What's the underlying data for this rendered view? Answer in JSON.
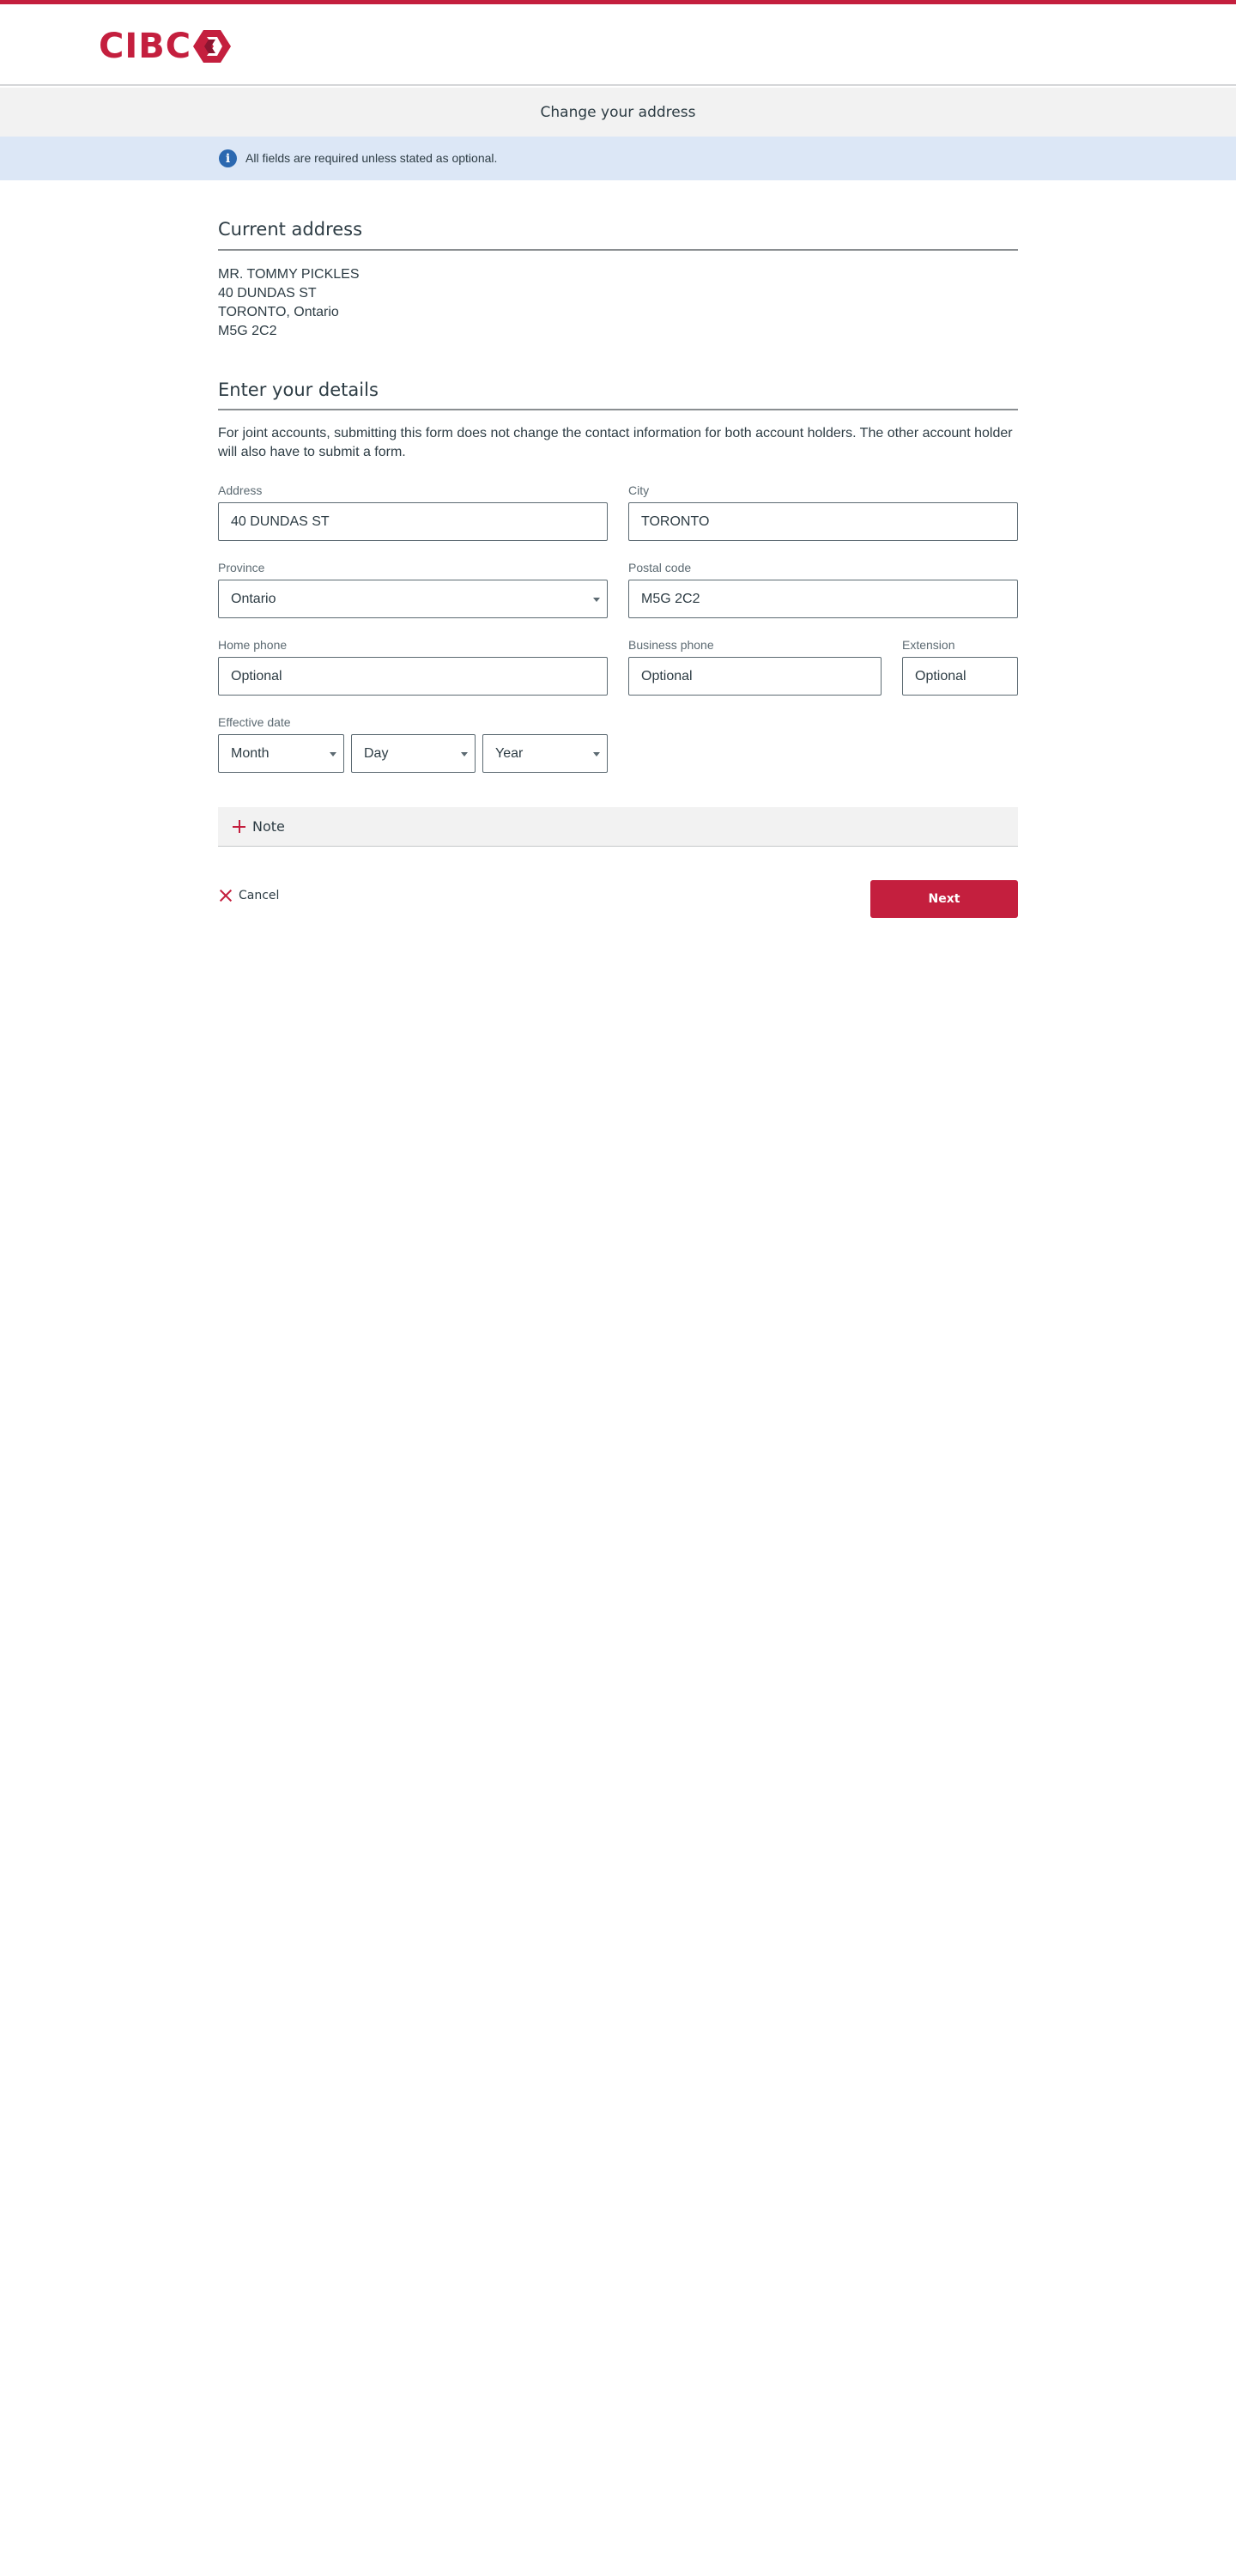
{
  "brand": {
    "name": "CIBC",
    "accent_color": "#c41f3e",
    "logo_icon": "cibc-chevron-logo"
  },
  "page": {
    "title": "Change your address"
  },
  "info_banner": {
    "icon": "info-icon",
    "text": "All fields are required unless stated as optional."
  },
  "current_address": {
    "heading": "Current address",
    "lines": [
      "MR. TOMMY PICKLES",
      "40 DUNDAS ST",
      "TORONTO, Ontario",
      "M5G 2C2"
    ]
  },
  "details": {
    "heading": "Enter your details",
    "notice": "For joint accounts, submitting this form does not change the contact information for both account holders. The other account holder will also have to submit a form.",
    "fields": {
      "address": {
        "label": "Address",
        "value": "40 DUNDAS ST"
      },
      "city": {
        "label": "City",
        "value": "TORONTO"
      },
      "province": {
        "label": "Province",
        "value": "Ontario"
      },
      "postal_code": {
        "label": "Postal code",
        "value": "M5G 2C2"
      },
      "home_phone": {
        "label": "Home phone",
        "placeholder": "Optional"
      },
      "business_phone": {
        "label": "Business phone",
        "placeholder": "Optional"
      },
      "extension": {
        "label": "Extension",
        "placeholder": "Optional"
      },
      "effective_date": {
        "label": "Effective date",
        "month": "Month",
        "day": "Day",
        "year": "Year"
      }
    }
  },
  "note": {
    "label": "Note",
    "icon": "plus-icon"
  },
  "actions": {
    "cancel_label": "Cancel",
    "cancel_icon": "close-icon",
    "next_label": "Next"
  }
}
